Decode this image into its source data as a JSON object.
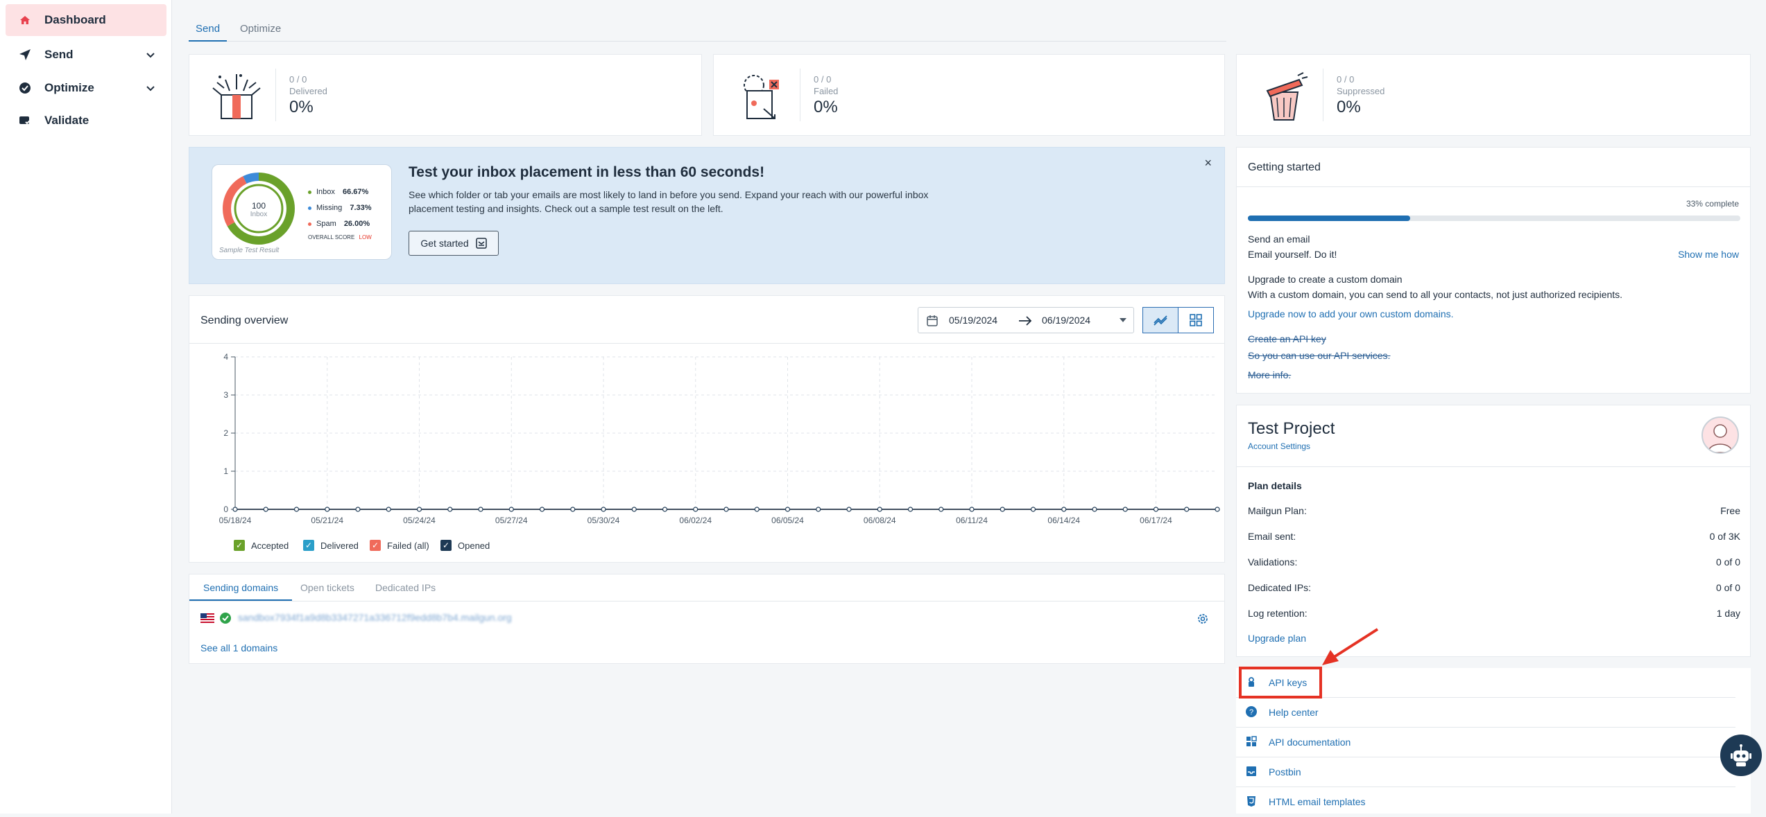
{
  "sidebar": {
    "items": [
      {
        "label": "Dashboard",
        "icon": "home-icon"
      },
      {
        "label": "Send",
        "icon": "send-icon"
      },
      {
        "label": "Optimize",
        "icon": "optimize-icon"
      },
      {
        "label": "Validate",
        "icon": "validate-icon"
      }
    ]
  },
  "tabs": [
    "Send",
    "Optimize"
  ],
  "stats": [
    {
      "count": "0 / 0",
      "label": "Delivered",
      "percent": "0%"
    },
    {
      "count": "0 / 0",
      "label": "Failed",
      "percent": "0%"
    },
    {
      "count": "0 / 0",
      "label": "Suppressed",
      "percent": "0%"
    }
  ],
  "banner": {
    "title": "Test your inbox placement in less than 60 seconds!",
    "description": "See which folder or tab your emails are most likely to land in before you send. Expand your reach with our powerful inbox placement testing and insights. Check out a sample test result on the left.",
    "button": "Get started",
    "close": "×",
    "sample": {
      "score": "100",
      "score_label": "Inbox",
      "rows": [
        {
          "label": "Inbox",
          "value": "66.67%",
          "color": "#6aa12a"
        },
        {
          "label": "Missing",
          "value": "7.33%",
          "color": "#3d8bd9"
        },
        {
          "label": "Spam",
          "value": "26.00%",
          "color": "#f06a5a"
        }
      ],
      "overall": "OVERALL SCORE",
      "overall_value": "LOW",
      "caption": "Sample Test Result"
    }
  },
  "overview": {
    "title": "Sending overview",
    "date_from": "05/19/2024",
    "date_to": "06/19/2024"
  },
  "chart_data": {
    "type": "line",
    "x": [
      "05/18/24",
      "05/19/24",
      "05/20/24",
      "05/21/24",
      "05/22/24",
      "05/23/24",
      "05/24/24",
      "05/25/24",
      "05/26/24",
      "05/27/24",
      "05/28/24",
      "05/29/24",
      "05/30/24",
      "05/31/24",
      "06/01/24",
      "06/02/24",
      "06/03/24",
      "06/04/24",
      "06/05/24",
      "06/06/24",
      "06/07/24",
      "06/08/24",
      "06/09/24",
      "06/10/24",
      "06/11/24",
      "06/12/24",
      "06/13/24",
      "06/14/24",
      "06/15/24",
      "06/16/24",
      "06/17/24",
      "06/18/24",
      "06/19/24"
    ],
    "x_tick_labels": [
      "05/18/24",
      "05/21/24",
      "05/24/24",
      "05/27/24",
      "05/30/24",
      "06/02/24",
      "06/05/24",
      "06/08/24",
      "06/11/24",
      "06/14/24",
      "06/17/24"
    ],
    "y_ticks": [
      "0",
      "1",
      "2",
      "3",
      "4"
    ],
    "ylim": [
      0,
      4
    ],
    "series": [
      {
        "name": "Accepted",
        "color": "#6aa12a",
        "values": [
          0,
          0,
          0,
          0,
          0,
          0,
          0,
          0,
          0,
          0,
          0,
          0,
          0,
          0,
          0,
          0,
          0,
          0,
          0,
          0,
          0,
          0,
          0,
          0,
          0,
          0,
          0,
          0,
          0,
          0,
          0,
          0,
          0
        ]
      },
      {
        "name": "Delivered",
        "color": "#2b9fc9",
        "values": [
          0,
          0,
          0,
          0,
          0,
          0,
          0,
          0,
          0,
          0,
          0,
          0,
          0,
          0,
          0,
          0,
          0,
          0,
          0,
          0,
          0,
          0,
          0,
          0,
          0,
          0,
          0,
          0,
          0,
          0,
          0,
          0,
          0
        ]
      },
      {
        "name": "Failed (all)",
        "color": "#f06a5a",
        "values": [
          0,
          0,
          0,
          0,
          0,
          0,
          0,
          0,
          0,
          0,
          0,
          0,
          0,
          0,
          0,
          0,
          0,
          0,
          0,
          0,
          0,
          0,
          0,
          0,
          0,
          0,
          0,
          0,
          0,
          0,
          0,
          0,
          0
        ]
      },
      {
        "name": "Opened",
        "color": "#1e3a55",
        "values": [
          0,
          0,
          0,
          0,
          0,
          0,
          0,
          0,
          0,
          0,
          0,
          0,
          0,
          0,
          0,
          0,
          0,
          0,
          0,
          0,
          0,
          0,
          0,
          0,
          0,
          0,
          0,
          0,
          0,
          0,
          0,
          0,
          0
        ]
      }
    ],
    "grid": true,
    "legend": "bottom-left"
  },
  "domains": {
    "tabs": [
      "Sending domains",
      "Open tickets",
      "Dedicated IPs"
    ],
    "row_value": "sandbox7934f1a9d8b3347271a336712f9edd8b7b4.mailgun.org",
    "see_all": "See all 1 domains"
  },
  "getting_started": {
    "title": "Getting started",
    "complete": "33% complete",
    "progress": 0.33,
    "step1_title": "Send an email",
    "step1_desc": "Email yourself. Do it!",
    "show_me_how": "Show me how",
    "step2_title": "Upgrade to create a custom domain",
    "step2_desc": "With a custom domain, you can send to all your contacts, not just authorized recipients.",
    "step2_link": "Upgrade now to add your own custom domains.",
    "step3_title": "Create an API key",
    "step3_desc": "So you can use our API services.",
    "step3_link": "More info."
  },
  "project": {
    "name": "Test Project",
    "account_settings": "Account Settings",
    "plan_details": "Plan details",
    "rows": [
      {
        "label": "Mailgun Plan:",
        "value": "Free"
      },
      {
        "label": "Email sent:",
        "value": "0 of 3K"
      },
      {
        "label": "Validations:",
        "value": "0 of 0"
      },
      {
        "label": "Dedicated IPs:",
        "value": "0 of 0"
      },
      {
        "label": "Log retention:",
        "value": "1 day"
      }
    ],
    "upgrade": "Upgrade plan"
  },
  "links": [
    {
      "label": "API keys",
      "icon": "key-icon"
    },
    {
      "label": "Help center",
      "icon": "help-icon"
    },
    {
      "label": "API documentation",
      "icon": "api-doc-icon"
    },
    {
      "label": "Postbin",
      "icon": "inbox-icon"
    },
    {
      "label": "HTML email templates",
      "icon": "html5-icon"
    }
  ],
  "colors": {
    "accent": "#1f6fb2",
    "highlight": "#e53224",
    "banner_bg": "#dbe9f6"
  }
}
